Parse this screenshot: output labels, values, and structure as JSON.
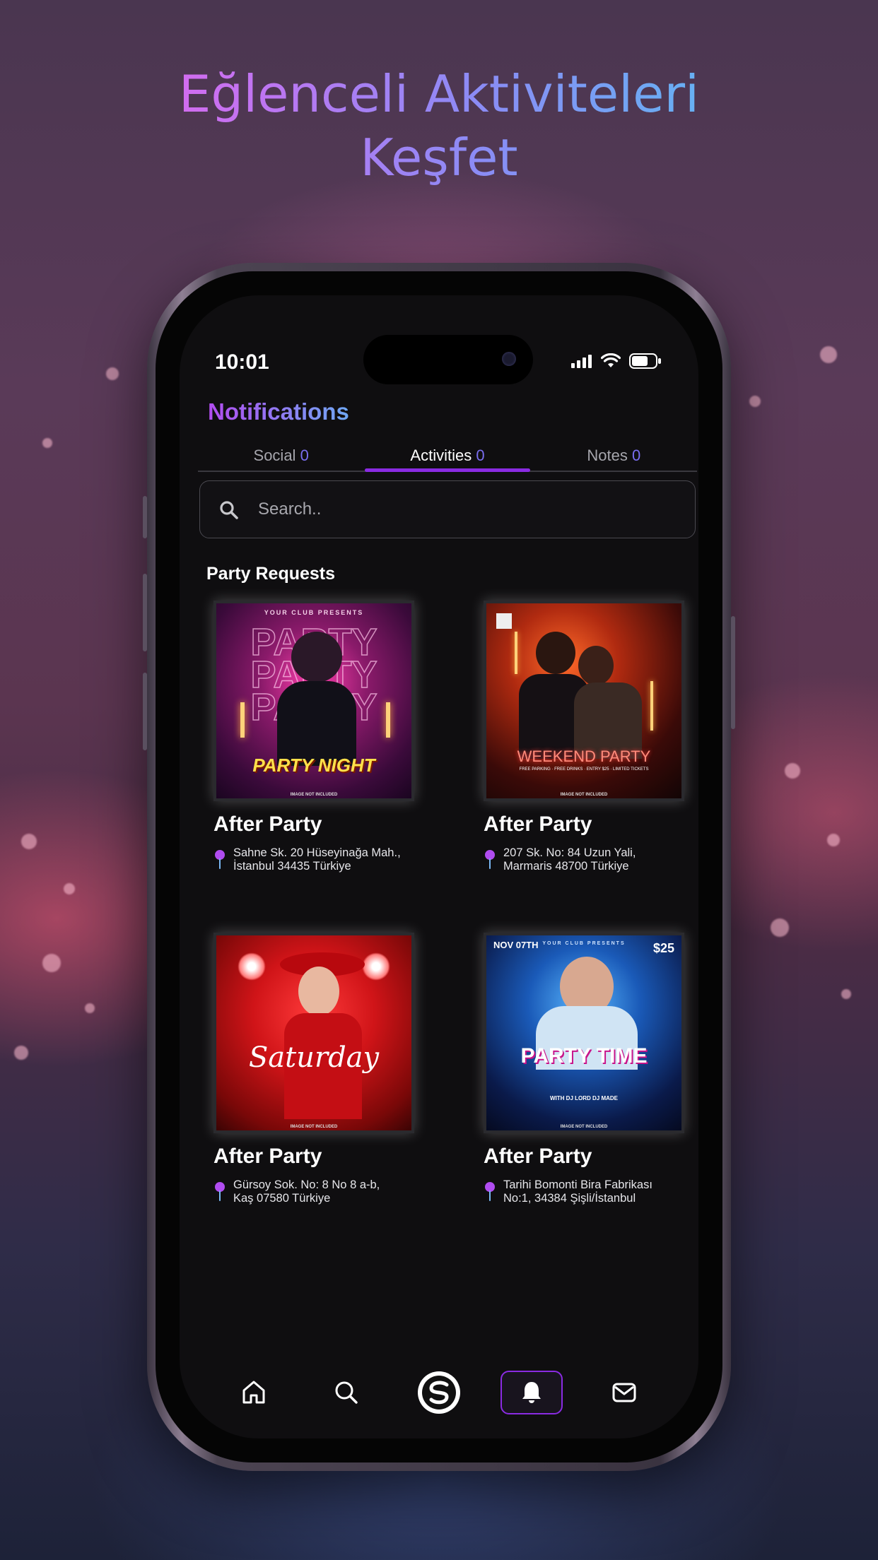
{
  "headline": {
    "line1": "Eğlenceli Aktiviteleri",
    "line2": "Keşfet"
  },
  "status_bar": {
    "time": "10:01"
  },
  "page": {
    "title": "Notifications"
  },
  "tabs": [
    {
      "label": "Social",
      "count": "0"
    },
    {
      "label": "Activities",
      "count": "0",
      "active": true
    },
    {
      "label": "Notes",
      "count": "0"
    }
  ],
  "search": {
    "placeholder": "Search.."
  },
  "section_title": "Party Requests",
  "events": [
    {
      "title": "After Party",
      "address_line1": "Sahne Sk. 20 Hüseyinağa Mah.,",
      "address_line2": "İstanbul 34435 Türkiye",
      "poster_text": "PARTY NIGHT",
      "poster_top": "YOUR CLUB PRESENTS",
      "poster_bottom": "IMAGE NOT INCLUDED"
    },
    {
      "title": "After Party",
      "address_line1": "207 Sk. No: 84 Uzun Yali,",
      "address_line2": "Marmaris 48700 Türkiye",
      "poster_text": "WEEKEND PARTY",
      "poster_top": "",
      "poster_bottom": "IMAGE NOT INCLUDED"
    },
    {
      "title": "After Party",
      "address_line1": "Gürsoy Sok. No: 8 No 8 a-b,",
      "address_line2": "Kaş 07580 Türkiye",
      "poster_text": "Saturday",
      "poster_top": "",
      "poster_bottom": "IMAGE NOT INCLUDED"
    },
    {
      "title": "After Party",
      "address_line1": "Tarihi Bomonti Bira Fabrikası",
      "address_line2": "No:1, 34384 Şişli/İstanbul",
      "poster_text": "PARTY TIME",
      "poster_top": "YOUR CLUB PRESENTS",
      "poster_bottom": "IMAGE NOT INCLUDED",
      "poster_date": "NOV 07TH",
      "poster_price": "$25"
    }
  ],
  "nav": {
    "items": [
      "home-icon",
      "search-icon",
      "logo-icon",
      "bell-icon",
      "mail-icon"
    ],
    "active": "bell-icon"
  },
  "colors": {
    "accent": "#8a2be2",
    "title_gradient_start": "#b24cf0",
    "title_gradient_end": "#6fa8f4"
  }
}
